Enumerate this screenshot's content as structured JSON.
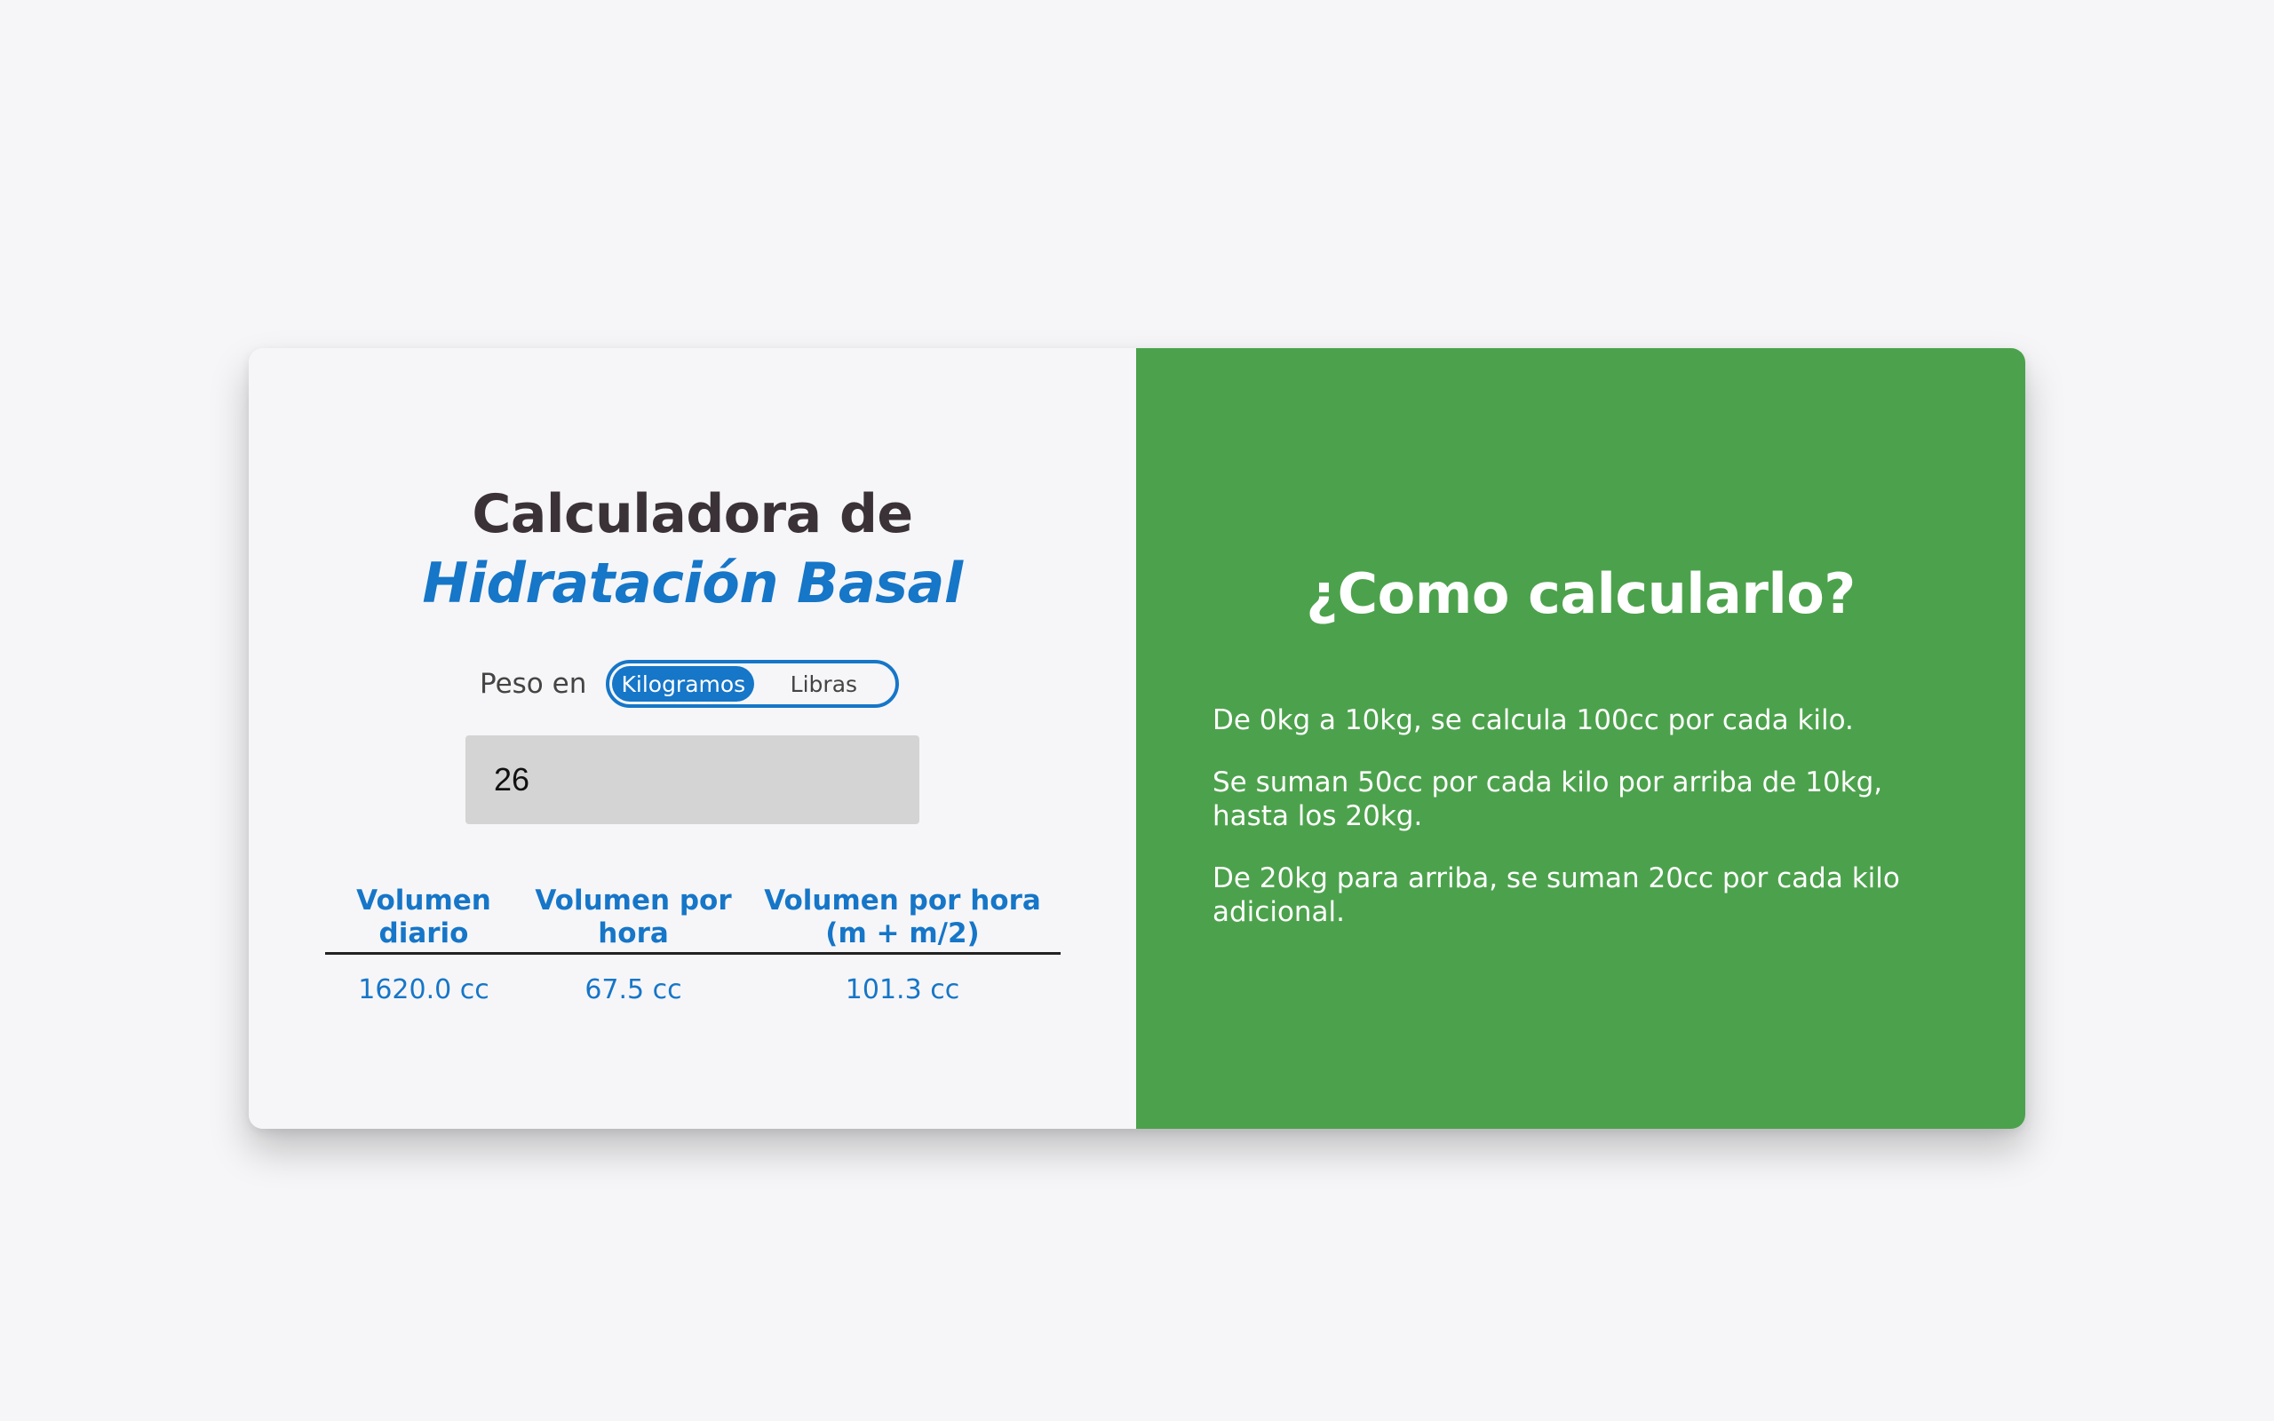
{
  "calculator": {
    "title_line1": "Calculadora de",
    "title_line2": "Hidratación Basal",
    "unit_label": "Peso en",
    "unit_options": [
      "Kilogramos",
      "Libras"
    ],
    "selected_unit": "Kilogramos",
    "weight_value": "26",
    "results": {
      "headers": [
        "Volumen diario",
        "Volumen por hora",
        "Volumen por hora (m + m/2)"
      ],
      "values": [
        "1620.0 cc",
        "67.5 cc",
        "101.3 cc"
      ]
    }
  },
  "info": {
    "title": "¿Como calcularlo?",
    "rules": [
      "De 0kg a 10kg, se calcula 100cc por cada kilo.",
      "Se suman 50cc por cada kilo por arriba de 10kg, hasta los 20kg.",
      "De 20kg para arriba, se suman 20cc por cada kilo adicional."
    ]
  },
  "colors": {
    "accent_blue": "#1676c8",
    "panel_green": "#4ca24c",
    "title_dark": "#3a3237",
    "background": "#f6f6f8"
  }
}
